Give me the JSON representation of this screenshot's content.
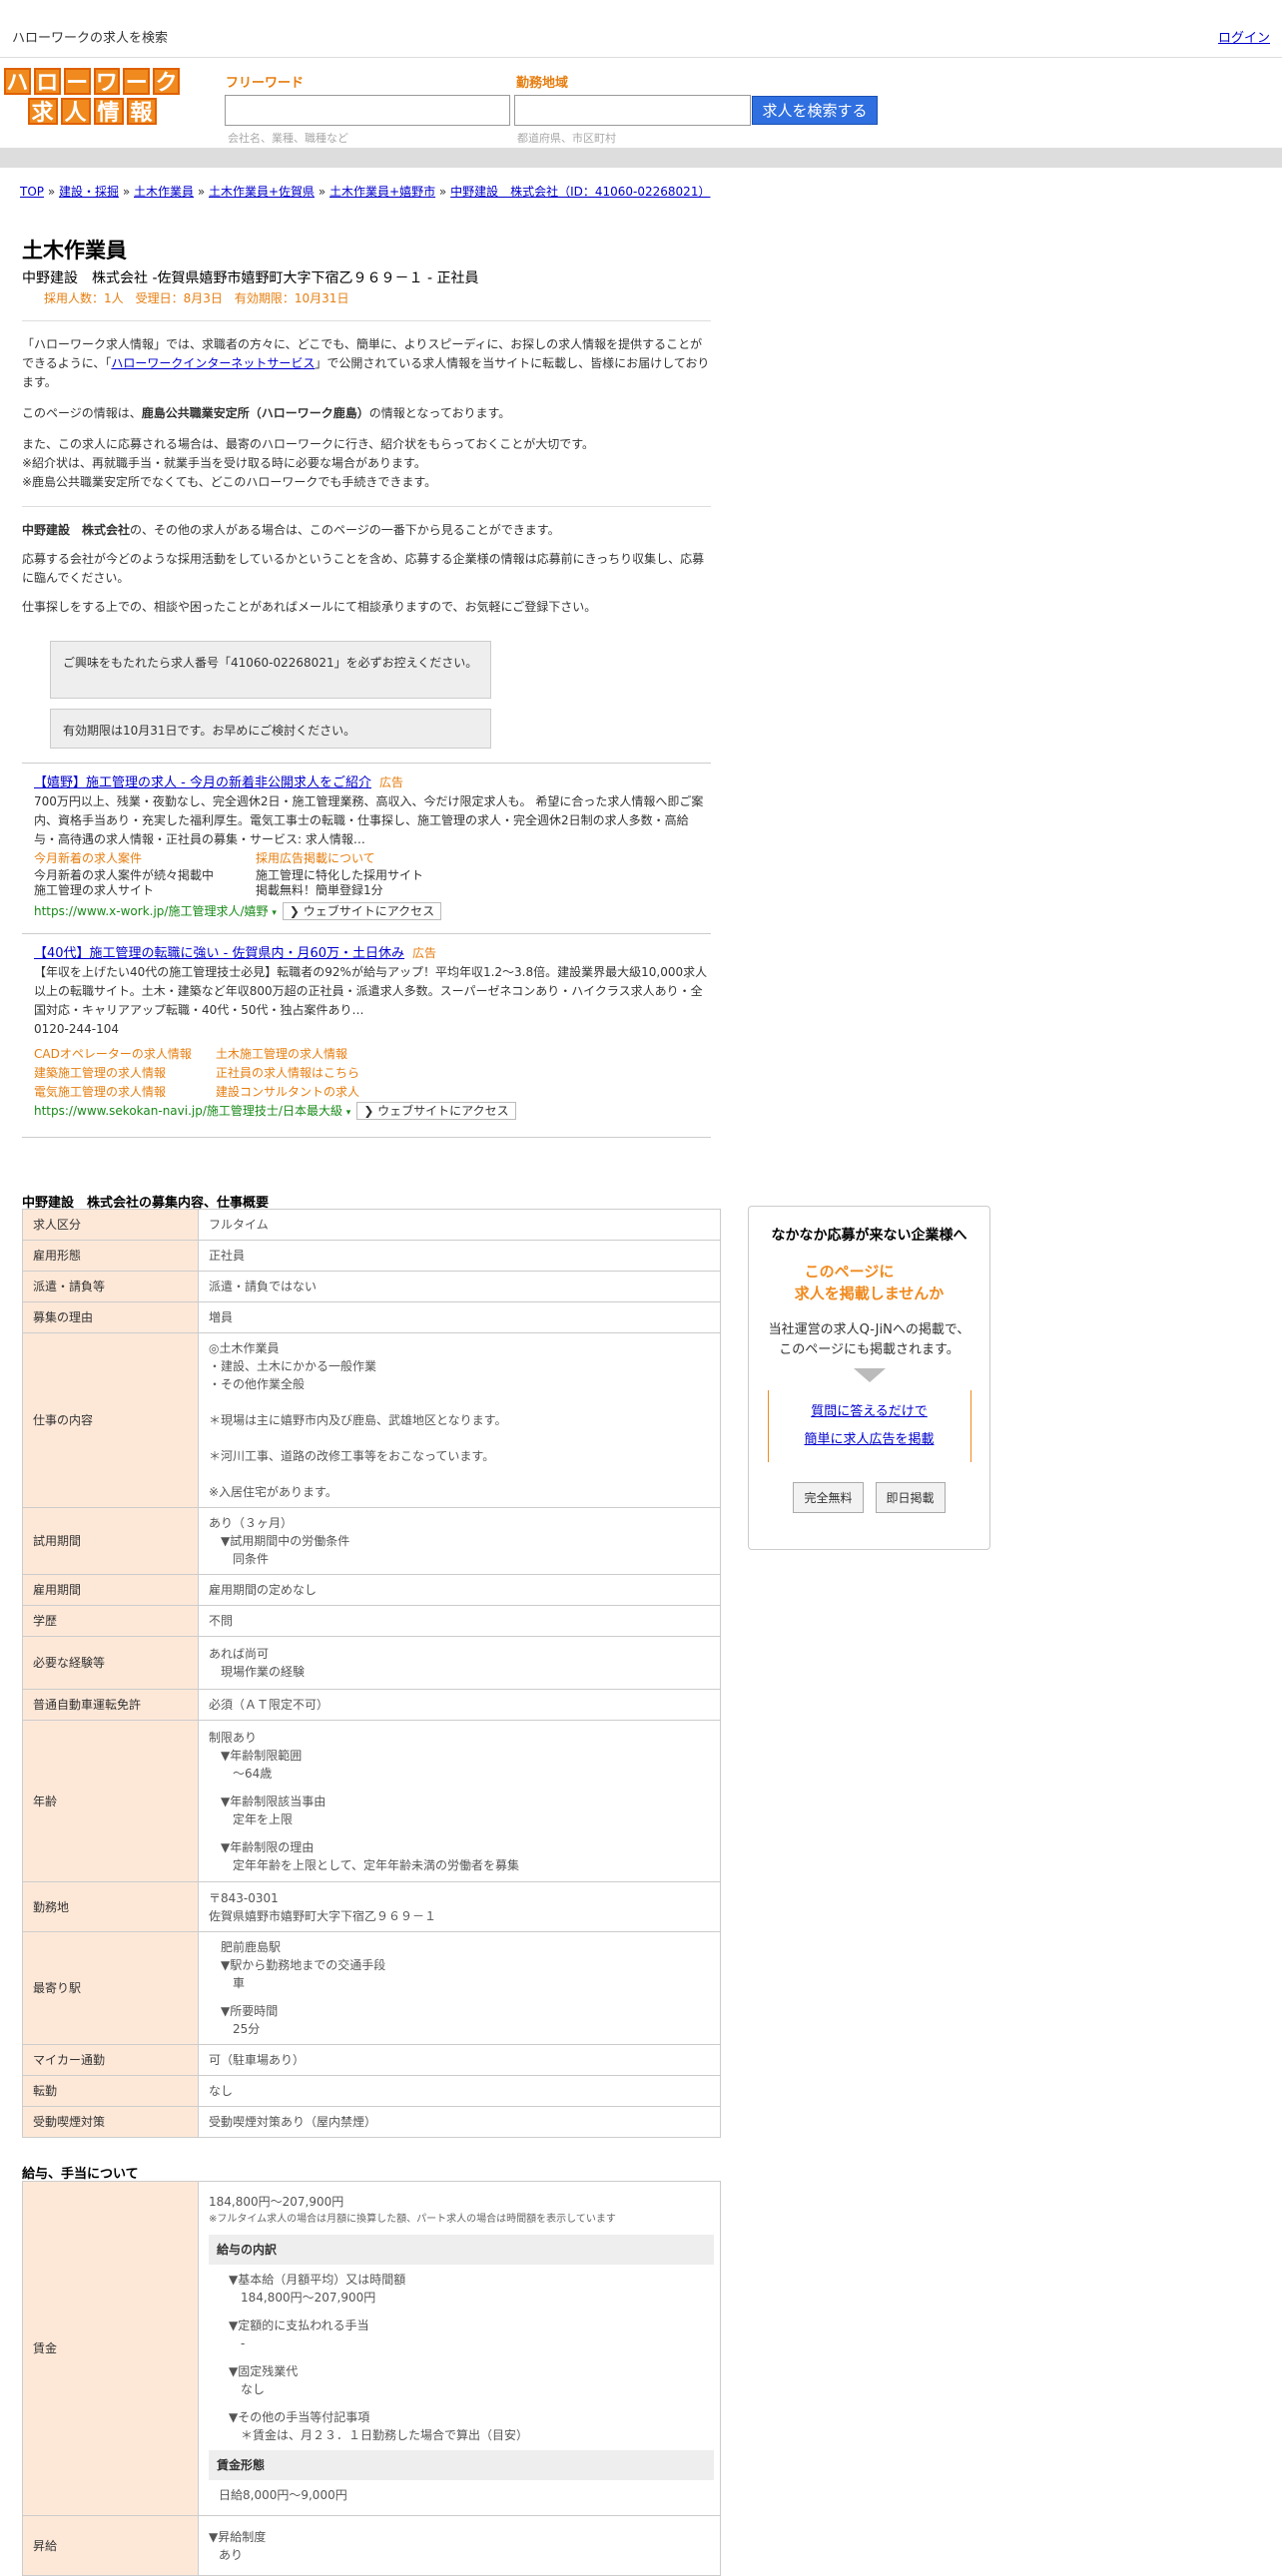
{
  "header": {
    "site_title": "ハローワークの求人を検索",
    "login": "ログイン",
    "logo_row1": [
      "ハ",
      "ロ",
      "ー",
      "ワ",
      "ー",
      "ク"
    ],
    "logo_row2": [
      "求",
      "人",
      "情",
      "報"
    ],
    "freeword_label": "フリーワード",
    "freeword_hint": "会社名、業種、職種など",
    "area_label": "勤務地域",
    "area_hint": "都道府県、市区町村",
    "search_button": "求人を検索する"
  },
  "breadcrumb": [
    "TOP",
    "建設・採掘",
    "土木作業員",
    "土木作業員+佐賀県",
    "土木作業員+嬉野市",
    "中野建設　株式会社（ID：41060-02268021）"
  ],
  "job": {
    "title": "土木作業員",
    "subtitle": "中野建設　株式会社 -佐賀県嬉野市嬉野町大字下宿乙９６９－１ - 正社員",
    "meta": "採用人数：1人　受理日：8月3日　有効期限：10月31日"
  },
  "intro": {
    "p1a": "「ハローワーク求人情報」では、求職者の方々に、どこでも、簡単に、よりスピーディに、お探しの求人情報を提供することができるように、「",
    "p1link": "ハローワークインターネットサービス",
    "p1b": "」で公開されている求人情報を当サイトに転載し、皆様にお届けしております。",
    "p2a": "このページの情報は、",
    "p2b": "鹿島公共職業安定所（ハローワーク鹿島）",
    "p2c": "の情報となっております。",
    "p3": "また、この求人に応募される場合は、最寄のハローワークに行き、紹介状をもらっておくことが大切です。",
    "p3b": "※紹介状は、再就職手当・就業手当を受け取る時に必要な場合があります。",
    "p3c": "※鹿島公共職業安定所でなくても、どこのハローワークでも手続きできます。",
    "p4a": "中野建設　株式会社",
    "p4b": "の、その他の求人がある場合は、このページの一番下から見ることができます。",
    "p5": "応募する会社が今どのような採用活動をしているかということを含め、応募する企業様の情報は応募前にきっちり収集し、応募に臨んでください。",
    "p6": "仕事探しをする上での、相談や困ったことがあればメールにて相談承りますので、お気軽にご登録下さい。",
    "box1": "ご興味をもたれたら求人番号「41060-02268021」を必ずお控えください。",
    "box2": "有効期限は10月31日です。お早めにご検討ください。"
  },
  "ads": [
    {
      "title": "【嬉野】施工管理の求人 - 今月の新着非公開求人をご紹介",
      "badge": "広告",
      "desc": "700万円以上、残業・夜勤なし、完全週休2日・施工管理業務、高収入、今だけ限定求人も。 希望に合った求人情報へ即ご案内、資格手当あり・充実した福利厚生。電気工事士の転職・仕事探し、施工管理の求人・完全週休2日制の求人多数・高給与・高待遇の求人情報・正社員の募集・サービス: 求人情報…",
      "sl1_title": "今月新着の求人案件",
      "sl1_d1": "今月新着の求人案件が続々掲載中",
      "sl1_d2": "施工管理の求人サイト",
      "sl2_title": "採用広告掲載について",
      "sl2_d1": "施工管理に特化した採用サイト",
      "sl2_d2": "掲載無料！簡単登録1分",
      "url": "https://www.x-work.jp/施工管理求人/嬉野",
      "visit": "❯ ウェブサイトにアクセス"
    },
    {
      "title": "【40代】施工管理の転職に強い - 佐賀県内・月60万・土日休み",
      "badge": "広告",
      "desc": "【年収を上げたい40代の施工管理技士必見】転職者の92%が給与アップ！平均年収1.2～3.8倍。建設業界最大級10,000求人以上の転職サイト。土木・建築など年収800万超の正社員・派遣求人多数。スーパーゼネコンあり・ハイクラス求人あり・全国対応・キャリアアップ転職・40代・50代・独占案件あり…",
      "phone": "0120-244-104",
      "links": [
        [
          "CADオペレーターの求人情報",
          "土木施工管理の求人情報"
        ],
        [
          "建築施工管理の求人情報",
          "正社員の求人情報はこちら"
        ],
        [
          "電気施工管理の求人情報",
          "建設コンサルタントの求人"
        ]
      ],
      "url": "https://www.sekokan-navi.jp/施工管理技士/日本最大級",
      "visit": "❯ ウェブサイトにアクセス"
    }
  ],
  "details_title": "中野建設　株式会社の募集内容、仕事概要",
  "details": [
    {
      "k": "求人区分",
      "v": [
        "フルタイム"
      ]
    },
    {
      "k": "雇用形態",
      "v": [
        "正社員"
      ]
    },
    {
      "k": "派遣・請負等",
      "v": [
        "派遣・請負ではない"
      ]
    },
    {
      "k": "募集の理由",
      "v": [
        "増員"
      ]
    },
    {
      "k": "仕事の内容",
      "v": [
        "◎土木作業員",
        "・建設、土木にかかる一般作業",
        "・その他作業全般",
        "",
        "＊現場は主に嬉野市内及び鹿島、武雄地区となります。",
        "",
        "＊河川工事、道路の改修工事等をおこなっています。",
        "",
        "※入居住宅があります。"
      ]
    },
    {
      "k": "試用期間",
      "v": [
        "あり（３ヶ月）",
        "　▼試用期間中の労働条件",
        "　　同条件"
      ]
    },
    {
      "k": "雇用期間",
      "v": [
        "雇用期間の定めなし"
      ]
    },
    {
      "k": "学歴",
      "v": [
        "不問"
      ]
    },
    {
      "k": "必要な経験等",
      "v": [
        "あれば尚可",
        "　現場作業の経験"
      ]
    },
    {
      "k": "普通自動車運転免許",
      "v": [
        "必須（ＡＴ限定不可）"
      ]
    },
    {
      "k": "年齢",
      "v": [
        "制限あり",
        "　▼年齢制限範囲",
        "　　〜64歳",
        "",
        "　▼年齢制限該当事由",
        "　　定年を上限",
        "",
        "　▼年齢制限の理由",
        "　　定年年齢を上限として、定年年齢未満の労働者を募集"
      ]
    },
    {
      "k": "勤務地",
      "v": [
        "〒843-0301",
        "佐賀県嬉野市嬉野町大字下宿乙９６９－１"
      ]
    },
    {
      "k": "最寄り駅",
      "v": [
        "　肥前鹿島駅",
        "　▼駅から勤務地までの交通手段",
        "　　車",
        "",
        "　▼所要時間",
        "　　25分"
      ]
    },
    {
      "k": "マイカー通勤",
      "v": [
        "可（駐車場あり）"
      ]
    },
    {
      "k": "転勤",
      "v": [
        "なし"
      ]
    },
    {
      "k": "受動喫煙対策",
      "v": [
        "受動喫煙対策あり（屋内禁煙）"
      ]
    }
  ],
  "salary_title": "給与、手当について",
  "salary": {
    "k": "賃金",
    "range": "184,800円〜207,900円",
    "note": "※フルタイム求人の場合は月額に換算した額、パート求人の場合は時間額を表示しています",
    "breakdown_h": "給与の内訳",
    "breakdown": [
      "▼基本給（月額平均）又は時間額",
      "　184,800円〜207,900円",
      "",
      "▼定額的に支払われる手当",
      "　-",
      "",
      "▼固定残業代",
      "　なし",
      "",
      "▼その他の手当等付記事項",
      "　＊賃金は、月２３．１日勤務した場合で算出（目安）"
    ],
    "form_h": "賃金形態",
    "form": "日給8,000円〜9,000円",
    "raise_k": "昇給",
    "raise": [
      "▼昇給制度",
      "あり"
    ]
  },
  "side": {
    "heading": "なかなか応募が来ない企業様へ",
    "orange1": "このページに",
    "orange2": "求人を掲載しませんか",
    "p1": "当社運営の求人Q-JiNへの掲載で、",
    "p2": "このページにも掲載されます。",
    "link1": "質問に答えるだけで",
    "link2": "簡単に求人広告を掲載",
    "btn1": "完全無料",
    "btn2": "即日掲載"
  }
}
